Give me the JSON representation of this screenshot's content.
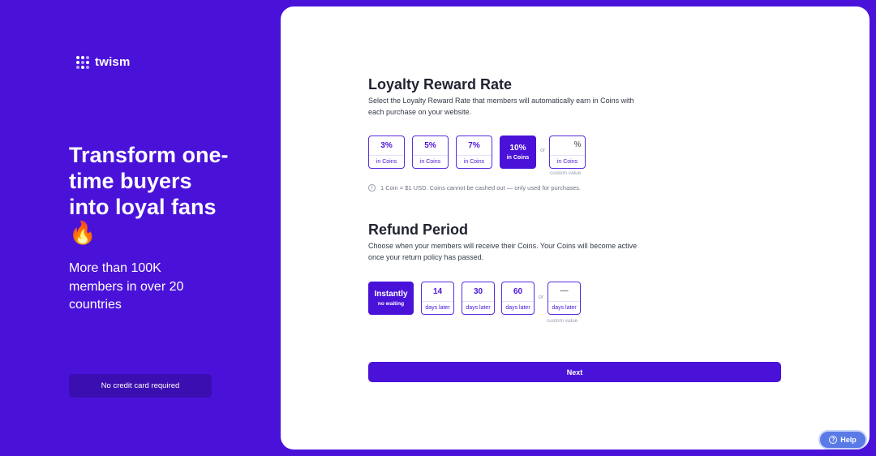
{
  "brand": {
    "name": "twism"
  },
  "hero": {
    "title": "Transform one-time buyers into loyal fans 🔥",
    "subtitle": "More than 100K members in over 20 countries",
    "badge": "No credit card required"
  },
  "loyalty": {
    "title": "Loyalty Reward Rate",
    "description": "Select the Loyalty Reward Rate that members will automatically earn in Coins with each purchase on your website.",
    "options": [
      {
        "value": "3%",
        "unit": "in Coins",
        "selected": false
      },
      {
        "value": "5%",
        "unit": "in Coins",
        "selected": false
      },
      {
        "value": "7%",
        "unit": "in Coins",
        "selected": false
      },
      {
        "value": "10%",
        "unit": "in Coins",
        "selected": true
      }
    ],
    "or": "or",
    "custom": {
      "suffix": "%",
      "unit": "in Coins",
      "caption": "custom value",
      "value": ""
    },
    "info": "1 Coin = $1 USD. Coins cannot be cashed out — only used for purchases."
  },
  "refund": {
    "title": "Refund Period",
    "description": "Choose when your members will receive their Coins. Your Coins will become active once your return policy has passed.",
    "instant": {
      "label": "Instantly",
      "sub": "no waiting",
      "selected": true
    },
    "options": [
      {
        "value": "14",
        "unit": "days later"
      },
      {
        "value": "30",
        "unit": "days later"
      },
      {
        "value": "60",
        "unit": "days later"
      }
    ],
    "or": "or",
    "custom": {
      "placeholder": "—",
      "unit": "days later",
      "caption": "custom value"
    }
  },
  "actions": {
    "next": "Next",
    "help": "Help"
  },
  "colors": {
    "brand": "#4a12d9",
    "help": "#5a7be6"
  }
}
